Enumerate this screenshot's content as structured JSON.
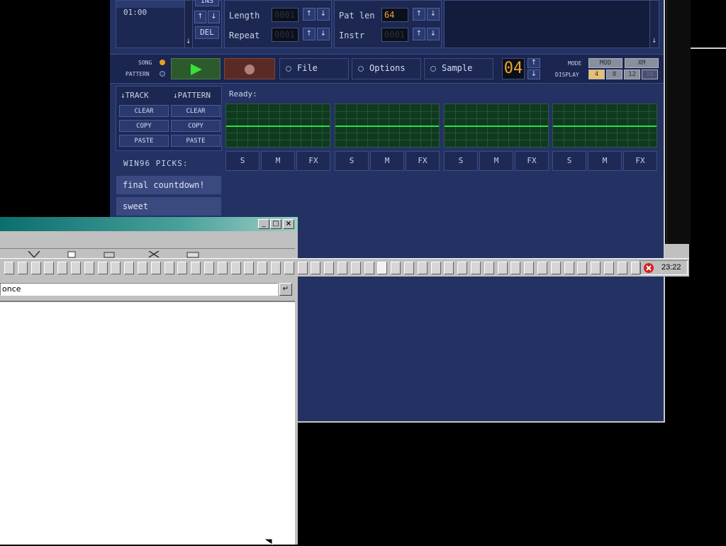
{
  "tracker": {
    "position_time": "01:00",
    "ins_label": "INS",
    "del_label": "DEL",
    "length_label": "Length",
    "repeat_label": "Repeat",
    "patlen_label": "Pat len",
    "instr_label": "Instr",
    "length_value": "0001",
    "repeat_value": "0001",
    "patlen_value": "64",
    "instr_value": "0001",
    "song_label": "SONG",
    "pattern_label": "PATTERN",
    "file_label": "File",
    "options_label": "Options",
    "sample_label": "Sample",
    "bpm_digits": "04",
    "mode_label": "MODE",
    "display_label": "DISPLAY",
    "mode_options": [
      "MOD",
      "XM"
    ],
    "display_options": [
      "4",
      "8",
      "12",
      "16"
    ],
    "track_header": "↓TRACK",
    "pattern_header": "↓PATTERN",
    "clear_label": "CLEAR",
    "copy_label": "COPY",
    "paste_label": "PASTE",
    "status": "Ready:",
    "channel_buttons": [
      "S",
      "M",
      "FX"
    ],
    "picks_title": "WIN96 PICKS:",
    "picks": [
      "final countdown!",
      "sweet"
    ],
    "arrow_up": "↑",
    "arrow_down": "↓"
  },
  "explorer": {
    "address_value": "once",
    "go_icon": "↵"
  },
  "taskbar": {
    "clock": "23:22"
  },
  "colors": {
    "tracker_bg": "#233263",
    "scope_wave": "#2be04a",
    "lcd_digit": "#f3a42a",
    "titlebar": "#0b6e6e"
  }
}
